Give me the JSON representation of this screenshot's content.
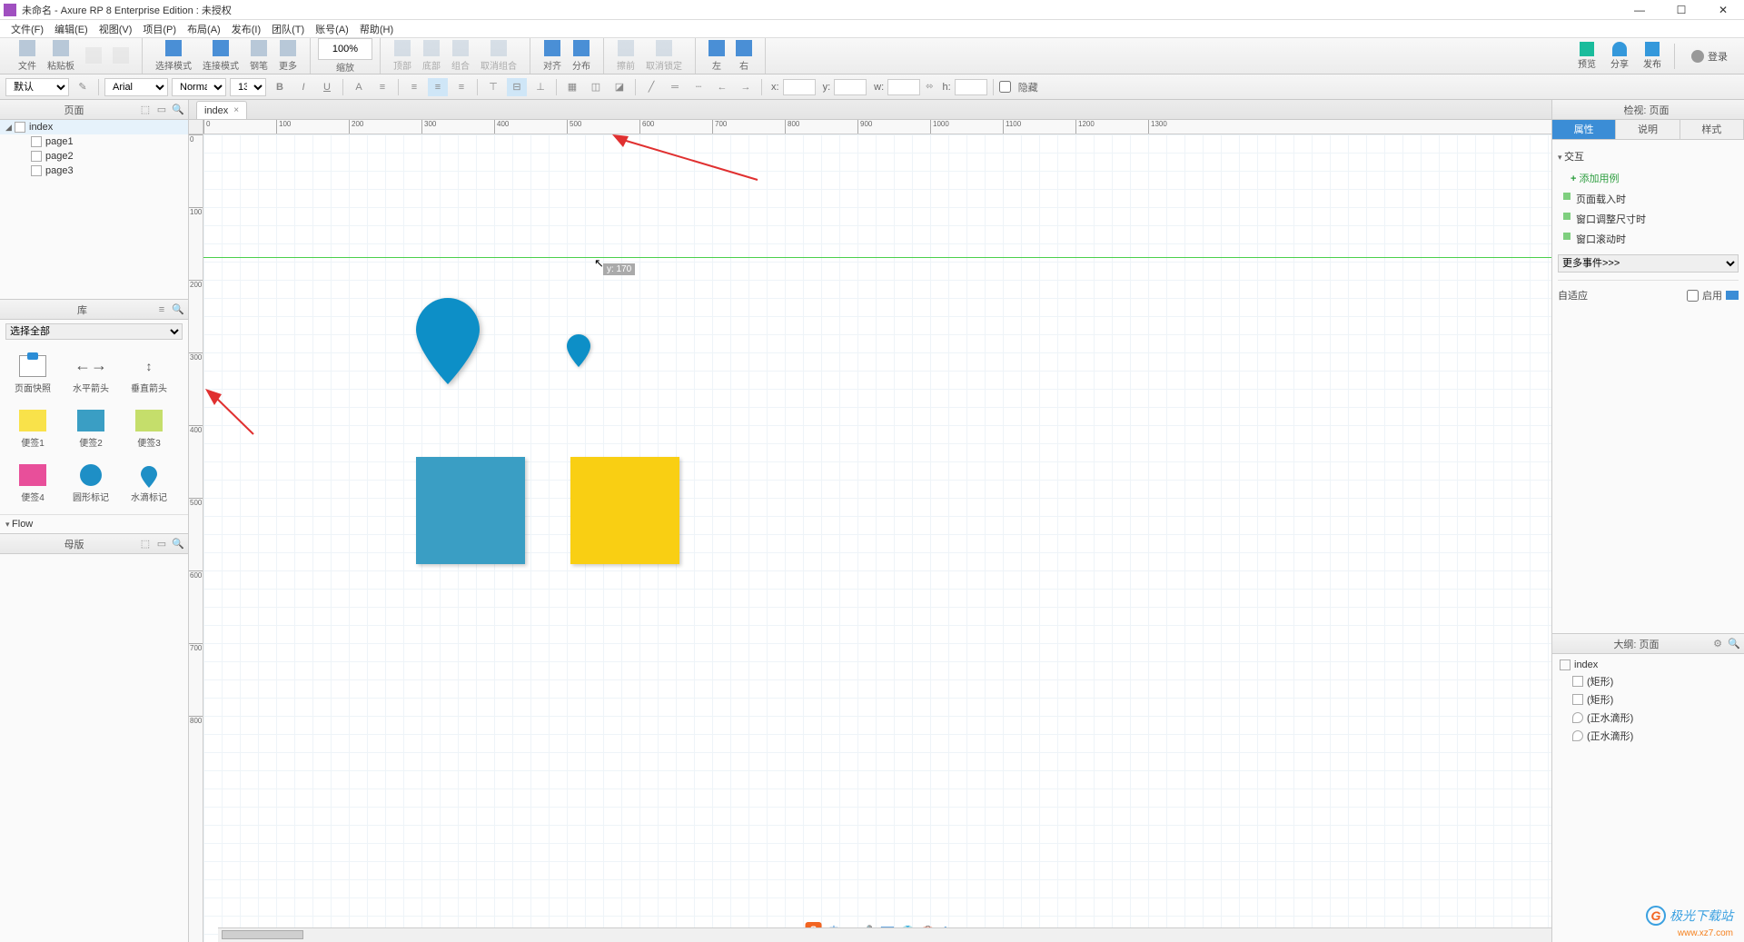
{
  "title": "未命名 - Axure RP 8 Enterprise Edition : 未授权",
  "menu": [
    "文件(F)",
    "编辑(E)",
    "视图(V)",
    "项目(P)",
    "布局(A)",
    "发布(I)",
    "团队(T)",
    "账号(A)",
    "帮助(H)"
  ],
  "toolbar": {
    "file_group": [
      "文件",
      "粘贴板"
    ],
    "select_mode": "选择模式",
    "connect_mode": "连接模式",
    "pen": "钢笔",
    "more": "更多",
    "zoom_value": "100%",
    "zoom_label": "缩放",
    "align": {
      "top": "顶部",
      "bottom": "底部",
      "group": "组合",
      "ungroup": "取消组合",
      "align_label": "对齐",
      "distribute": "分布",
      "front": "擦前",
      "back": "取消锁定",
      "left": "左",
      "right": "右"
    },
    "right": {
      "preview": "预览",
      "share": "分享",
      "publish": "发布",
      "login": "登录"
    }
  },
  "formatbar": {
    "preset": "默认",
    "font": "Arial",
    "style": "Normal",
    "size": "13",
    "x_label": "x:",
    "y_label": "y:",
    "w_label": "w:",
    "h_label": "h:",
    "hidden": "隐藏"
  },
  "pages_panel": {
    "title": "页面",
    "items": [
      {
        "name": "index",
        "level": 0,
        "expanded": true
      },
      {
        "name": "page1",
        "level": 1
      },
      {
        "name": "page2",
        "level": 1
      },
      {
        "name": "page3",
        "level": 1
      }
    ]
  },
  "library_panel": {
    "title": "库",
    "select_all": "选择全部",
    "items": [
      {
        "name": "页面快照",
        "shape": "snapshot"
      },
      {
        "name": "水平箭头",
        "shape": "harrow"
      },
      {
        "name": "垂直箭头",
        "shape": "varrow"
      },
      {
        "name": "便签1",
        "shape": "note",
        "color": "#f9e24a"
      },
      {
        "name": "便签2",
        "shape": "note",
        "color": "#3a9ec4"
      },
      {
        "name": "便签3",
        "shape": "note",
        "color": "#c5de6b"
      },
      {
        "name": "便签4",
        "shape": "note",
        "color": "#e84f9a"
      },
      {
        "name": "圆形标记",
        "shape": "circle",
        "color": "#1e8fc6"
      },
      {
        "name": "水滴标记",
        "shape": "pin",
        "color": "#1e8fc6"
      }
    ],
    "flow_section": "Flow"
  },
  "master_panel": {
    "title": "母版"
  },
  "canvas": {
    "tab": "index",
    "cursor_hint": "y: 170",
    "ruler_h": [
      0,
      100,
      200,
      300,
      400,
      500,
      600,
      700,
      800,
      900,
      1000,
      1100,
      1200,
      1300
    ],
    "ruler_v": [
      0,
      100,
      200,
      300,
      400,
      500,
      600,
      700,
      800
    ]
  },
  "inspector": {
    "header": "检视: 页面",
    "tabs": [
      "属性",
      "说明",
      "样式"
    ],
    "active_tab": 0,
    "interaction_title": "交互",
    "add_case": "添加用例",
    "events": [
      "页面载入时",
      "窗口调整尺寸时",
      "窗口滚动时"
    ],
    "more_events": "更多事件>>>",
    "adaptive": "自适应",
    "enable": "启用"
  },
  "outline": {
    "header": "大纲: 页面",
    "root": "index",
    "items": [
      "(矩形)",
      "(矩形)",
      "(正水滴形)",
      "(正水滴形)"
    ]
  },
  "watermark": "极光下载站",
  "watermark_url": "www.xz7.com",
  "status_icons": [
    "中",
    "●",
    "●",
    "●",
    "●",
    "●",
    "●"
  ]
}
